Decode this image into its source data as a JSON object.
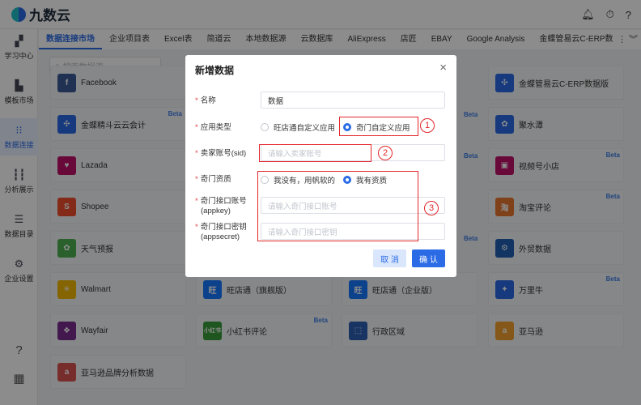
{
  "app": {
    "name": "九数云"
  },
  "sidebar": {
    "items": [
      {
        "label": "学习中心",
        "icon": "learning-icon"
      },
      {
        "label": "模板市场",
        "icon": "template-icon"
      },
      {
        "label": "数据连接",
        "icon": "data-connect-icon"
      },
      {
        "label": "分析展示",
        "icon": "analysis-icon"
      },
      {
        "label": "数据目录",
        "icon": "catalog-icon"
      },
      {
        "label": "企业设置",
        "icon": "settings-icon"
      }
    ]
  },
  "tabs": [
    {
      "label": "数据连接市场"
    },
    {
      "label": "企业项目表"
    },
    {
      "label": "Excel表"
    },
    {
      "label": "简道云"
    },
    {
      "label": "本地数据源"
    },
    {
      "label": "云数据库"
    },
    {
      "label": "AliExpress"
    },
    {
      "label": "店匠"
    },
    {
      "label": "EBAY"
    },
    {
      "label": "Google Analysis"
    },
    {
      "label": "金蝶管易云C-ERP数据版"
    }
  ],
  "search": {
    "placeholder": "搜索数据源"
  },
  "cards": [
    {
      "name": "Facebook",
      "color": "#3b5998",
      "glyph": "f",
      "beta": ""
    },
    {
      "name": "金蝶精斗云云会计",
      "color": "#2b6be6",
      "glyph": "✣",
      "beta": "Beta"
    },
    {
      "name": "Lazada",
      "color": "#c0126b",
      "glyph": "♥",
      "beta": ""
    },
    {
      "name": "Shopee",
      "color": "#ee4d2d",
      "glyph": "S",
      "beta": ""
    },
    {
      "name": "天气预报",
      "color": "#4caf50",
      "glyph": "✿",
      "beta": ""
    },
    {
      "name": "Walmart",
      "color": "#f2b705",
      "glyph": "✳",
      "beta": ""
    },
    {
      "name": "Wayfair",
      "color": "#7b2c8f",
      "glyph": "❖",
      "beta": ""
    },
    {
      "name": "亚马逊品牌分析数据",
      "color": "#d9534f",
      "glyph": "a",
      "beta": ""
    },
    {
      "name": "旺店通（旗舰版）",
      "color": "#1677ff",
      "glyph": "旺",
      "beta": ""
    },
    {
      "name": "小红书评论",
      "color": "#3a9b3a",
      "glyph": "小红书",
      "beta": "Beta"
    },
    {
      "name": "旺店通（企业版）",
      "color": "#1677ff",
      "glyph": "旺",
      "beta": ""
    },
    {
      "name": "行政区域",
      "color": "#2b5fb4",
      "glyph": "⬚",
      "beta": ""
    },
    {
      "name": "金蝶管易云C-ERP数据版",
      "color": "#2b6be6",
      "glyph": "✣",
      "beta": ""
    },
    {
      "name": "聚水潭",
      "color": "#2b6be6",
      "glyph": "✿",
      "beta": ""
    },
    {
      "name": "视频号小店",
      "color": "#c0126b",
      "glyph": "▣",
      "beta": "Beta"
    },
    {
      "name": "淘宝评论",
      "color": "#e8772e",
      "glyph": "淘",
      "beta": "Beta"
    },
    {
      "name": "外贸数据",
      "color": "#1f5fb5",
      "glyph": "⚙",
      "beta": ""
    },
    {
      "name": "万里牛",
      "color": "#2b6be6",
      "glyph": "✦",
      "beta": "Beta"
    },
    {
      "name": "亚马逊",
      "color": "#f2a12e",
      "glyph": "a",
      "beta": ""
    }
  ],
  "partial_betas": [
    "Beta",
    "Beta",
    "Beta"
  ],
  "modal": {
    "title": "新增数据",
    "close": "×",
    "fields": {
      "name": {
        "label": "名称",
        "value": "数据"
      },
      "app_type": {
        "label": "应用类型",
        "option1": "旺店通自定义应用",
        "option2": "奇门自定义应用"
      },
      "seller_account": {
        "label": "卖家账号(sid)",
        "placeholder": "请输入卖家账号"
      },
      "qimen_resource": {
        "label": "奇门资质",
        "option1": "我没有，用帆软的",
        "option2": "我有资质"
      },
      "appkey": {
        "label": "奇门接口账号",
        "sublabel": "(appkey)",
        "placeholder": "请输入奇门接口账号"
      },
      "appsecret": {
        "label": "奇门接口密钥",
        "sublabel": "(appsecret)",
        "placeholder": "请输入奇门接口密钥"
      }
    },
    "cancel": "取 消",
    "ok": "确 认"
  },
  "annotations": [
    "1",
    "2",
    "3"
  ]
}
